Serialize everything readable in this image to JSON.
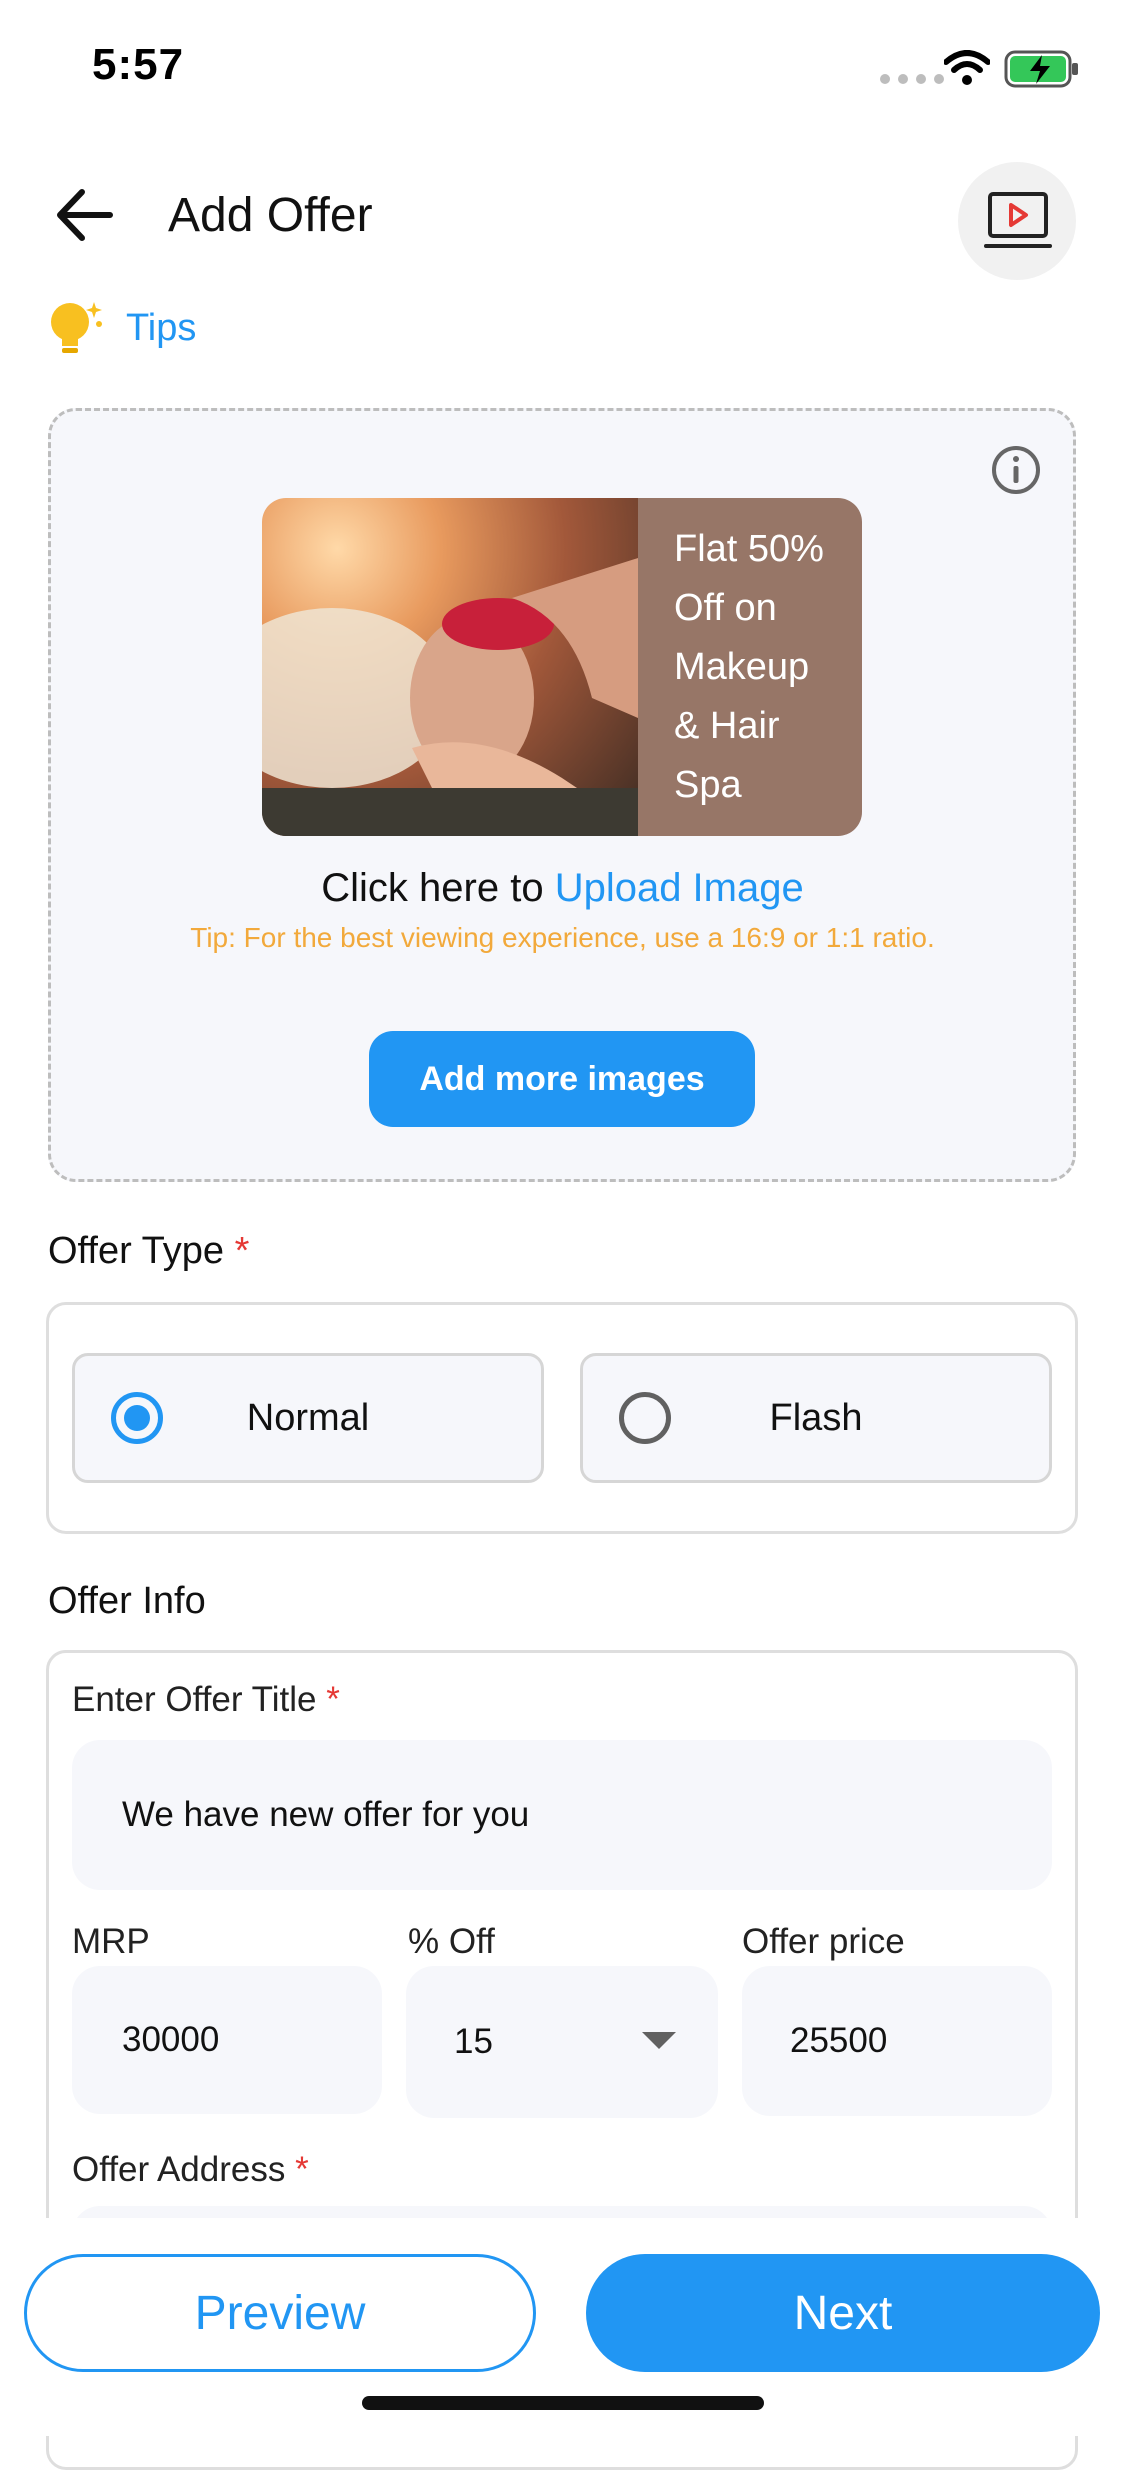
{
  "status_bar": {
    "time": "5:57"
  },
  "header": {
    "title": "Add Offer"
  },
  "tips": {
    "label": "Tips"
  },
  "upload": {
    "promo_lines": [
      "Flat 50%",
      "Off on",
      "Makeup",
      "& Hair",
      "Spa"
    ],
    "prompt_prefix": "Click here to ",
    "prompt_link": "Upload Image",
    "tip": "Tip: For the best viewing experience, use a 16:9 or 1:1 ratio.",
    "add_more_label": "Add more images"
  },
  "offer_type": {
    "title": "Offer Type",
    "required_mark": "*",
    "options": [
      {
        "label": "Normal",
        "selected": true
      },
      {
        "label": "Flash",
        "selected": false
      }
    ]
  },
  "offer_info": {
    "title": "Offer Info",
    "offer_title_label": "Enter Offer Title",
    "offer_title_required": "*",
    "offer_title_value": "We have new offer for you",
    "mrp_label": "MRP",
    "mrp_value": "30000",
    "percent_off_label": "% Off",
    "percent_off_value": "15",
    "offer_price_label": "Offer price",
    "offer_price_value": "25500",
    "address_label": "Offer Address",
    "address_required": "*"
  },
  "actions": {
    "preview_label": "Preview",
    "next_label": "Next"
  },
  "colors": {
    "accent": "#2196f3",
    "tip": "#f2a93b",
    "required": "#e53935",
    "promo_bg": "#977667"
  }
}
